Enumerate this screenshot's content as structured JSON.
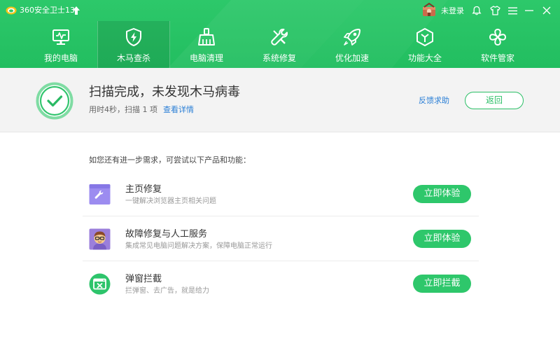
{
  "app": {
    "title": "360安全卫士13"
  },
  "titlebar": {
    "login_label": "未登录"
  },
  "tabs": [
    {
      "label": "我的电脑",
      "icon": "monitor-icon"
    },
    {
      "label": "木马查杀",
      "icon": "shield-bolt-icon",
      "active": true
    },
    {
      "label": "电脑清理",
      "icon": "broom-icon"
    },
    {
      "label": "系统修复",
      "icon": "wrench-icon"
    },
    {
      "label": "优化加速",
      "icon": "rocket-icon"
    },
    {
      "label": "功能大全",
      "icon": "cube-icon"
    },
    {
      "label": "软件管家",
      "icon": "clover-icon"
    }
  ],
  "result": {
    "title": "扫描完成，未发现木马病毒",
    "meta": "用时4秒，扫描 1 项",
    "detail_link": "查看详情",
    "feedback_link": "反馈求助",
    "back_button": "返回"
  },
  "suggestions": {
    "intro": "如您还有进一步需求，可尝试以下产品和功能：",
    "items": [
      {
        "title": "主页修复",
        "desc": "一键解决浏览器主页相关问题",
        "button": "立即体验",
        "icon": "homepage-repair-icon"
      },
      {
        "title": "故障修复与人工服务",
        "desc": "集成常见电脑问题解决方案，保障电脑正常运行",
        "button": "立即体验",
        "icon": "support-person-icon"
      },
      {
        "title": "弹窗拦截",
        "desc": "拦弹窗、去广告，就是给力",
        "button": "立即拦截",
        "icon": "popup-block-icon"
      }
    ]
  },
  "colors": {
    "header_green": "#2dc86a",
    "accent_green": "#2ec76b",
    "link_blue": "#2b7fd6",
    "result_bg": "#f3f3f3"
  }
}
